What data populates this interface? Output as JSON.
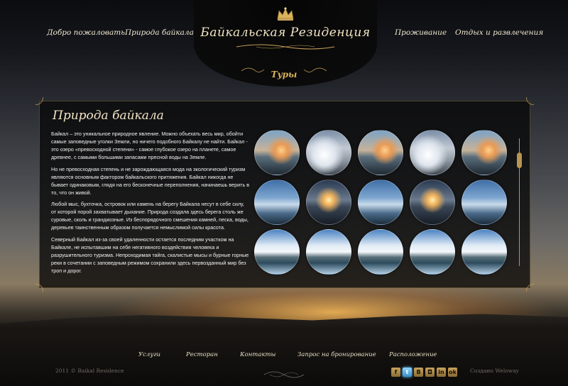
{
  "nav": {
    "left": [
      "Добро пожаловать",
      "Природа байкала"
    ],
    "right": [
      "Проживание",
      "Отдых и развлечения"
    ],
    "center": "Туры"
  },
  "logo": {
    "name": "Байкальская Резиденция",
    "icon": "crown-icon"
  },
  "panel": {
    "title": "Природа байкала",
    "paragraphs": [
      "Байкал – это уникальное природное явление. Можно объехать весь мир, обойти самые заповедные уголки Земли, но ничего подобного Байкалу не найти. Байкал - это озеро «превосходной степени» - самое глубокое озеро на планете, самое древнее, с самыми большими запасами пресной воды на Земле.",
      "Но не превосходная степень и не зарождающаяся мода на экологический туризм являются основным фактором байкальского притяжения. Байкал никогда не бывает одинаковым, глядя на его бесконечные переполнения, начинаешь верить в то, что он живой.",
      "Любой мыс, бухточка, островок или камень на берегу Байкала несут в себе силу, от которой порой захватывает дыхание. Природа создала здесь берега столь же суровые, сколь и грандиозные. Из беспорядочного смешения камней, песка, воды, деревьев таинственным образом получается немыслимой силы красота.",
      "Северный Байкал из-за своей удаленности остается последним участком на Байкале, не испытавшим на себе негативного воздействия человека и разрушительного туризма. Непроходимая тайга, скалистые мысы и бурные горные реки в сочетании с заповедным режимом сохранили здесь первозданный мир без троп и дорог."
    ],
    "photo_rows": [
      [
        "sunset-tree",
        "snowy-tree",
        "sunset-tree",
        "snowy-tree",
        "sunset-tree"
      ],
      [
        "ice-fishing",
        "ice-sunset",
        "ice-fishing",
        "ice-sunset",
        "ice-fishing"
      ],
      [
        "cloudy-lake",
        "cloudy-lake",
        "cloudy-lake",
        "cloudy-lake",
        "cloudy-lake"
      ]
    ]
  },
  "footer": {
    "links": [
      "Услуги",
      "Ресторан",
      "Контакты",
      "Запрос на бронирование",
      "Расположение"
    ],
    "copyright": "2011 © Baikal Residence",
    "created": "Создано Weloway",
    "social": [
      {
        "icon": "facebook-icon",
        "glyph": "f"
      },
      {
        "icon": "twitter-icon",
        "glyph": "t"
      },
      {
        "icon": "vkontakte-icon",
        "glyph": "В"
      },
      {
        "icon": "instagram-icon",
        "glyph": "◘"
      },
      {
        "icon": "linkedin-icon",
        "glyph": "in"
      },
      {
        "icon": "odnoklassniki-icon",
        "glyph": "ok"
      }
    ]
  },
  "colors": {
    "gold": "#c9a35c",
    "text": "#f1e7cf"
  }
}
